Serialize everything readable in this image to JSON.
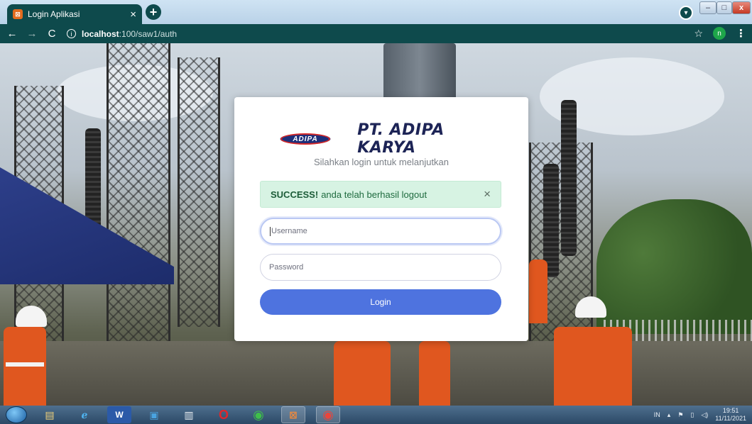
{
  "browser": {
    "tab_title": "Login Aplikasi",
    "tab_favicon": "xampp-icon",
    "tab_close": "×",
    "new_tab": "+",
    "url_host": "localhost",
    "url_path": ":100/saw1/auth",
    "profile_initial": "n",
    "window_controls": {
      "minimize": "–",
      "maximize": "□",
      "close": "x"
    }
  },
  "login": {
    "logo_text": "ADIPA",
    "company_name": "PT. ADIPA KARYA",
    "subtitle": "Silahkan login untuk melanjutkan",
    "alert": {
      "strong": "SUCCESS!",
      "message": "anda telah berhasil logout",
      "close": "×",
      "color": "#d7f3e3"
    },
    "username_placeholder": "Username",
    "password_placeholder": "Password",
    "login_button": "Login",
    "button_color": "#4e73df"
  },
  "taskbar": {
    "apps": [
      "explorer-icon",
      "ie-icon",
      "word-icon",
      "media-icon",
      "notepad-icon",
      "opera-icon",
      "chrome-alt-icon",
      "xampp-icon",
      "chrome-icon"
    ],
    "tray_lang": "IN",
    "time": "19:51",
    "date": "11/11/2021"
  }
}
